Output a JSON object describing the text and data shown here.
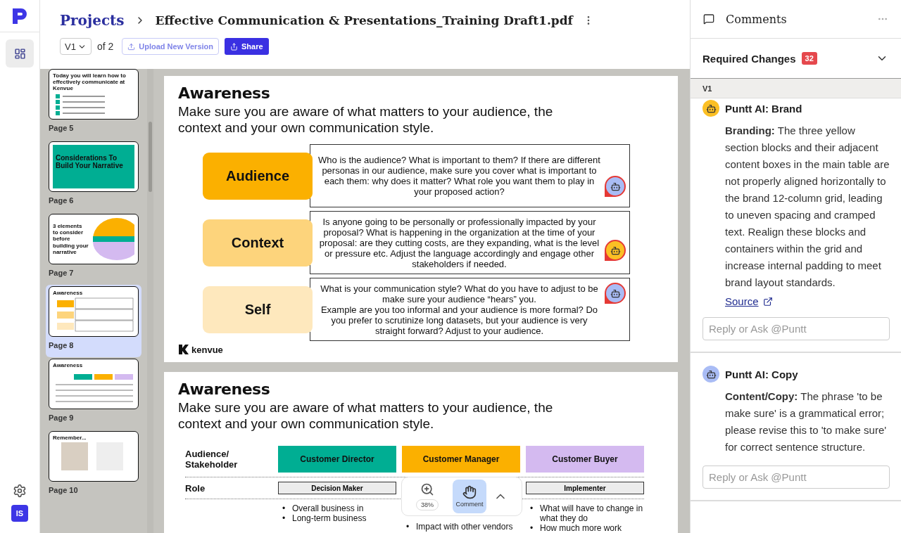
{
  "sidebar": {
    "nav_items": [
      {
        "selected": true
      }
    ],
    "avatar": "IS"
  },
  "header": {
    "breadcrumb": "Projects",
    "title": "Effective Communication & Presentations_Training Draft1.pdf",
    "version": "V1",
    "version_total": "of 2",
    "upload_button": "Upload New Version",
    "share_button": "Share"
  },
  "thumbnails": [
    {
      "kind": "list",
      "title": "Today you will learn how to effectively communicate at Kenvue",
      "label": "Page 5",
      "selected": false
    },
    {
      "kind": "cover",
      "title": "Considerations To Build Your Narrative",
      "label": "Page 6",
      "selected": false
    },
    {
      "kind": "circle",
      "title": "3 elements to consider before building your narrative",
      "label": "Page 7",
      "selected": false
    },
    {
      "kind": "rows",
      "title": "Awareness",
      "label": "Page 8",
      "selected": true
    },
    {
      "kind": "table",
      "title": "Awareness",
      "label": "Page 9",
      "selected": false
    },
    {
      "kind": "photos",
      "title": "Remember...",
      "label": "Page 10",
      "selected": false
    }
  ],
  "slides": [
    {
      "kind": "rows",
      "heading": "Awareness",
      "subtitle": "Make sure you are aware of what matters to your audience, the context and your own communication style.",
      "logo": "kenvue",
      "rows": [
        {
          "label": "Audience",
          "color": "#fbb000",
          "text": "Who is the audience? What is important to them? If there are different personas in our audience, make sure you cover what is important to each them: why does it matter? What role you want them to play in your proposed action?",
          "marker": {
            "color": "#a9bcf5"
          }
        },
        {
          "label": "Context",
          "color": "#fdd47c",
          "text": "Is anyone going to be personally or professionally impacted by your proposal? What is happening in the organization at the time of your proposal: are they cutting costs, are they expanding, what is the level or pressure etc. Adjust the language accordingly and engage other stakeholders if needed.",
          "marker": {
            "color": "#fbbf24"
          }
        },
        {
          "label": "Self",
          "color": "#fee8bd",
          "text": "What is your communication style? What do you have to adjust to be make sure your audience “hears” you.\nExample are you too informal and your audience is more formal? Do you prefer to scrutinize long datasets, but your audience is very straight forward? Adjust to your audience.",
          "marker": {
            "color": "#a9bcf5"
          }
        }
      ]
    },
    {
      "kind": "table",
      "heading": "Awareness",
      "subtitle": "Make sure you are aware of what matters to your audience, the context and your own communication style.",
      "row_header": "Audience/ Stakeholder",
      "columns": [
        {
          "label": "Customer Director",
          "color": "#00ae93",
          "role": "Decision Maker",
          "bullets": [
            "Overall business in",
            "Long-term business"
          ]
        },
        {
          "label": "Customer Manager",
          "color": "#fbb000",
          "bullets": [
            "Impact with other vendors"
          ]
        },
        {
          "label": "Customer Buyer",
          "color": "#d4baf0",
          "role": "Implementer",
          "bullets": [
            "What will have to change in what they do",
            "How much more work"
          ]
        }
      ],
      "role_label": "Role",
      "bullet": "•"
    }
  ],
  "viewer_toolbar": {
    "zoom": "38%",
    "comment_button": "Comment",
    "comment_selected": true
  },
  "comments_panel": {
    "title": "Comments",
    "section": {
      "title": "Required Changes",
      "count": "32"
    },
    "group": "V1",
    "comments": [
      {
        "author": "Puntt AI: Brand",
        "color": "#fbbf24",
        "body": "**Branding:** The three yellow section blocks and their adjacent content boxes in the main table are not properly aligned horizontally to the brand 12-column grid, leading to uneven spacing and cramped text. Realign these blocks and containers within the grid and increase internal padding to meet brand layout standards.",
        "link": "Source",
        "reply_placeholder": "Reply or Ask @Puntt"
      },
      {
        "author": "Puntt AI: Copy",
        "color": "#a9bcf5",
        "body": "**Content/Copy:** The phrase 'to be make sure' is a grammatical error; please revise this to 'to make sure' for correct sentence structure.",
        "reply_placeholder": "Reply or Ask @Puntt"
      }
    ]
  }
}
